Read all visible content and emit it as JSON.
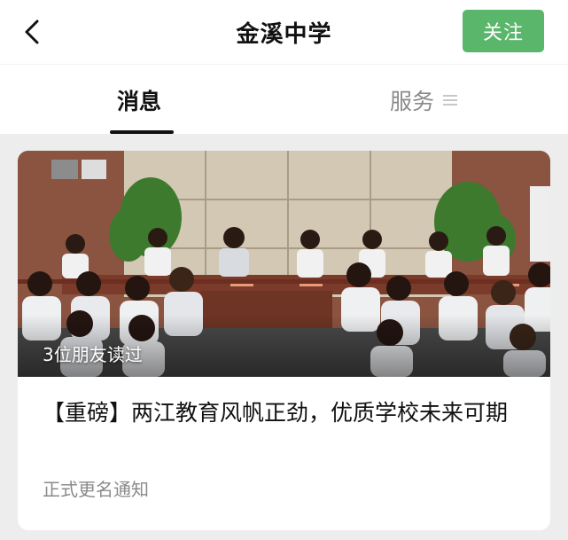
{
  "header": {
    "title": "金溪中学",
    "follow_label": "关注"
  },
  "tabs": [
    {
      "label": "消息",
      "active": true
    },
    {
      "label": "服务",
      "active": false
    }
  ],
  "article": {
    "read_badge": "3位朋友读过",
    "title": "【重磅】两江教育风帆正劲，优质学校未来可期",
    "subtitle": "正式更名通知"
  },
  "colors": {
    "follow_button": "#5ab66b",
    "background": "#ededed"
  },
  "icons": {
    "back": "chevron-left-icon",
    "services_menu": "menu-icon"
  }
}
